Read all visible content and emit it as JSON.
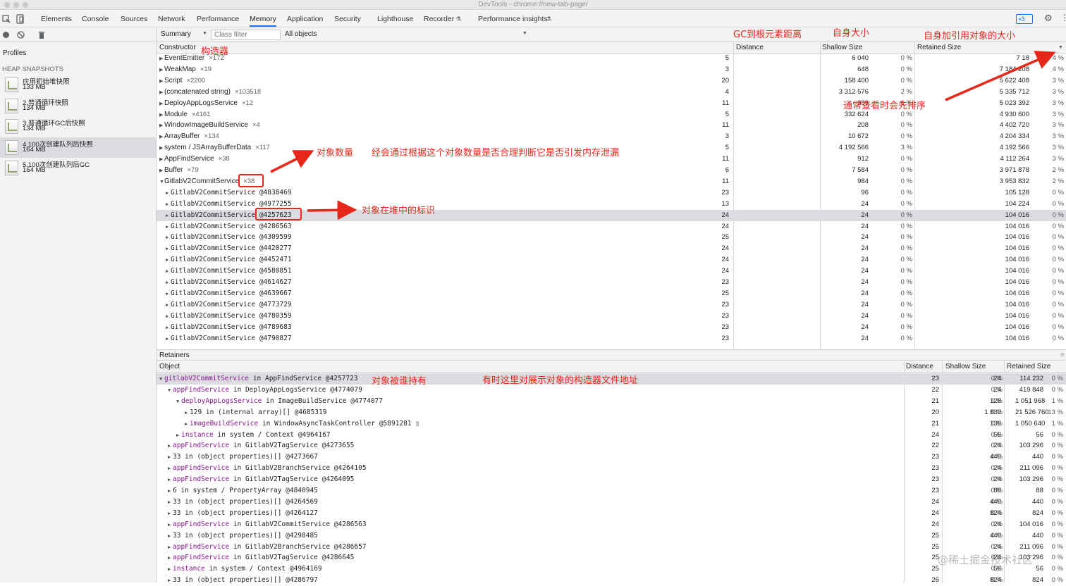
{
  "window": {
    "title": "DevTools - chrome://new-tab-page/"
  },
  "tabs": [
    "Elements",
    "Console",
    "Sources",
    "Network",
    "Performance",
    "Memory",
    "Application",
    "Security",
    "Lighthouse",
    "Recorder",
    "Performance insights"
  ],
  "active_tab": "Memory",
  "issues_badge": "3",
  "toolbar": {
    "view": "Summary",
    "class_filter_placeholder": "Class filter",
    "objects": "All objects"
  },
  "sidebar": {
    "profiles_label": "Profiles",
    "section": "HEAP SNAPSHOTS",
    "snapshots": [
      {
        "name": "应用初始堆快照",
        "size": "133 MB"
      },
      {
        "name": "2.普通循环快照",
        "size": "134 MB"
      },
      {
        "name": "3.普通循环GC后快照",
        "size": "134 MB"
      },
      {
        "name": "4.100次创建队列后快照",
        "size": "164 MB"
      },
      {
        "name": "5.100次创建队列后GC",
        "size": "164 MB"
      }
    ],
    "selected_index": 3
  },
  "summary": {
    "headers": {
      "constructor": "Constructor",
      "distance": "Distance",
      "shallow": "Shallow Size",
      "retained": "Retained Size"
    },
    "rows": [
      {
        "name": "EventEmitter",
        "count": "×172",
        "dist": "5",
        "shallow": "6 040",
        "sp": "0 %",
        "retained": "7 18",
        "rp": "4 %"
      },
      {
        "name": "WeakMap",
        "count": "×19",
        "dist": "3",
        "shallow": "648",
        "sp": "0 %",
        "retained": "7 184 208",
        "rp": "4 %"
      },
      {
        "name": "Script",
        "count": "×2200",
        "dist": "20",
        "shallow": "158 400",
        "sp": "0 %",
        "retained": "5 622 408",
        "rp": "3 %"
      },
      {
        "name": "(concatenated string)",
        "count": "×103518",
        "dist": "4",
        "shallow": "3 312 576",
        "sp": "2 %",
        "retained": "5 335 712",
        "rp": "3 %"
      },
      {
        "name": "DeployAppLogsService",
        "count": "×12",
        "dist": "11",
        "shallow": "289",
        "sp": "0 %",
        "retained": "5 023 392",
        "rp": "3 %"
      },
      {
        "name": "Module",
        "count": "×4161",
        "dist": "5",
        "shallow": "332 624",
        "sp": "0 %",
        "retained": "4 930 600",
        "rp": "3 %"
      },
      {
        "name": "WindowImageBuildService",
        "count": "×4",
        "dist": "11",
        "shallow": "208",
        "sp": "0 %",
        "retained": "4 402 720",
        "rp": "3 %"
      },
      {
        "name": "ArrayBuffer",
        "count": "×134",
        "dist": "3",
        "shallow": "10 672",
        "sp": "0 %",
        "retained": "4 204 334",
        "rp": "3 %"
      },
      {
        "name": "system / JSArrayBufferData",
        "count": "×117",
        "dist": "5",
        "shallow": "4 192 566",
        "sp": "3 %",
        "retained": "4 192 566",
        "rp": "3 %"
      },
      {
        "name": "AppFindService",
        "count": "×38",
        "dist": "11",
        "shallow": "912",
        "sp": "0 %",
        "retained": "4 112 264",
        "rp": "3 %"
      },
      {
        "name": "Buffer",
        "count": "×79",
        "dist": "6",
        "shallow": "7 584",
        "sp": "0 %",
        "retained": "3 971 878",
        "rp": "2 %"
      },
      {
        "name": "GitlabV2CommitService",
        "count": "×38",
        "dist": "11",
        "shallow": "984",
        "sp": "0 %",
        "retained": "3 953 832",
        "rp": "2 %",
        "expanded": true
      }
    ],
    "children": [
      {
        "name": "GitlabV2CommitService @4838469",
        "dist": "23",
        "shallow": "96",
        "sp": "0 %",
        "retained": "105 128",
        "rp": "0 %"
      },
      {
        "name": "GitlabV2CommitService @4977255",
        "dist": "13",
        "shallow": "24",
        "sp": "0 %",
        "retained": "104 224",
        "rp": "0 %"
      },
      {
        "name": "GitlabV2CommitService @4257623",
        "dist": "24",
        "shallow": "24",
        "sp": "0 %",
        "retained": "104 016",
        "rp": "0 %",
        "selected": true
      },
      {
        "name": "GitlabV2CommitService @4286563",
        "dist": "24",
        "shallow": "24",
        "sp": "0 %",
        "retained": "104 016",
        "rp": "0 %"
      },
      {
        "name": "GitlabV2CommitService @4309599",
        "dist": "25",
        "shallow": "24",
        "sp": "0 %",
        "retained": "104 016",
        "rp": "0 %"
      },
      {
        "name": "GitlabV2CommitService @4420277",
        "dist": "24",
        "shallow": "24",
        "sp": "0 %",
        "retained": "104 016",
        "rp": "0 %"
      },
      {
        "name": "GitlabV2CommitService @4452471",
        "dist": "24",
        "shallow": "24",
        "sp": "0 %",
        "retained": "104 016",
        "rp": "0 %"
      },
      {
        "name": "GitlabV2CommitService @4580851",
        "dist": "24",
        "shallow": "24",
        "sp": "0 %",
        "retained": "104 016",
        "rp": "0 %"
      },
      {
        "name": "GitlabV2CommitService @4614627",
        "dist": "23",
        "shallow": "24",
        "sp": "0 %",
        "retained": "104 016",
        "rp": "0 %"
      },
      {
        "name": "GitlabV2CommitService @4639667",
        "dist": "25",
        "shallow": "24",
        "sp": "0 %",
        "retained": "104 016",
        "rp": "0 %"
      },
      {
        "name": "GitlabV2CommitService @4773729",
        "dist": "23",
        "shallow": "24",
        "sp": "0 %",
        "retained": "104 016",
        "rp": "0 %"
      },
      {
        "name": "GitlabV2CommitService @4780359",
        "dist": "23",
        "shallow": "24",
        "sp": "0 %",
        "retained": "104 016",
        "rp": "0 %"
      },
      {
        "name": "GitlabV2CommitService @4789683",
        "dist": "23",
        "shallow": "24",
        "sp": "0 %",
        "retained": "104 016",
        "rp": "0 %"
      },
      {
        "name": "GitlabV2CommitService @4790827",
        "dist": "23",
        "shallow": "24",
        "sp": "0 %",
        "retained": "104 016",
        "rp": "0 %"
      }
    ]
  },
  "retainers": {
    "title": "Retainers",
    "headers": {
      "object": "Object",
      "distance": "Distance",
      "shallow": "Shallow Size",
      "retained": "Retained Size"
    },
    "rows": [
      {
        "indent": 0,
        "open": true,
        "prop": "gitlabV2CommitService",
        "rest": " in AppFindService @4257723",
        "dist": "23",
        "shallow": "24",
        "sp": "0 %",
        "retained": "114 232",
        "rp": "0 %",
        "selected": true
      },
      {
        "indent": 1,
        "open": true,
        "prop": "appFindService",
        "rest": " in DeployAppLogsService @4774079",
        "dist": "22",
        "shallow": "24",
        "sp": "0 %",
        "retained": "419 848",
        "rp": "0 %"
      },
      {
        "indent": 2,
        "open": true,
        "prop": "deployAppLogsService",
        "rest": " in ImageBuildService @4774077",
        "dist": "21",
        "shallow": "128",
        "sp": "0 %",
        "retained": "1 051 968",
        "rp": "1 %"
      },
      {
        "indent": 3,
        "open": false,
        "prop": "",
        "rest": "129 in (internal array)[] @4685319",
        "dist": "20",
        "shallow": "1 832",
        "sp": "0 %",
        "retained": "21 526 760",
        "rp": "13 %"
      },
      {
        "indent": 3,
        "open": false,
        "prop": "imageBuildService",
        "rest": " in WindowAsyncTaskController @5891281 ▯",
        "dist": "21",
        "shallow": "136",
        "sp": "0 %",
        "retained": "1 050 640",
        "rp": "1 %"
      },
      {
        "indent": 2,
        "open": false,
        "prop": "instance",
        "rest": " in system / Context @4964167",
        "dist": "24",
        "shallow": "56",
        "sp": "0 %",
        "retained": "56",
        "rp": "0 %"
      },
      {
        "indent": 1,
        "open": false,
        "prop": "appFindService",
        "rest": " in GitlabV2TagService @4273655",
        "dist": "22",
        "shallow": "24",
        "sp": "0 %",
        "retained": "103 296",
        "rp": "0 %"
      },
      {
        "indent": 1,
        "open": false,
        "prop": "",
        "rest": "33 in (object properties)[] @4273667",
        "dist": "23",
        "shallow": "440",
        "sp": "0 %",
        "retained": "440",
        "rp": "0 %"
      },
      {
        "indent": 1,
        "open": false,
        "prop": "appFindService",
        "rest": " in GitlabV2BranchService @4264105",
        "dist": "23",
        "shallow": "24",
        "sp": "0 %",
        "retained": "211 096",
        "rp": "0 %"
      },
      {
        "indent": 1,
        "open": false,
        "prop": "appFindService",
        "rest": " in GitlabV2TagService @4264095",
        "dist": "23",
        "shallow": "24",
        "sp": "0 %",
        "retained": "103 296",
        "rp": "0 %"
      },
      {
        "indent": 1,
        "open": false,
        "prop": "",
        "rest": "6 in system / PropertyArray @4840945",
        "dist": "23",
        "shallow": "88",
        "sp": "0 %",
        "retained": "88",
        "rp": "0 %"
      },
      {
        "indent": 1,
        "open": false,
        "prop": "",
        "rest": "33 in (object properties)[] @4264569",
        "dist": "24",
        "shallow": "440",
        "sp": "0 %",
        "retained": "440",
        "rp": "0 %"
      },
      {
        "indent": 1,
        "open": false,
        "prop": "",
        "rest": "33 in (object properties)[] @4264127",
        "dist": "24",
        "shallow": "824",
        "sp": "0 %",
        "retained": "824",
        "rp": "0 %"
      },
      {
        "indent": 1,
        "open": false,
        "prop": "appFindService",
        "rest": " in GitlabV2CommitService @4286563",
        "dist": "24",
        "shallow": "24",
        "sp": "0 %",
        "retained": "104 016",
        "rp": "0 %"
      },
      {
        "indent": 1,
        "open": false,
        "prop": "",
        "rest": "33 in (object properties)[] @4298485",
        "dist": "25",
        "shallow": "440",
        "sp": "0 %",
        "retained": "440",
        "rp": "0 %"
      },
      {
        "indent": 1,
        "open": false,
        "prop": "appFindService",
        "rest": " in GitlabV2BranchService @4286657",
        "dist": "25",
        "shallow": "24",
        "sp": "0 %",
        "retained": "211 096",
        "rp": "0 %"
      },
      {
        "indent": 1,
        "open": false,
        "prop": "appFindService",
        "rest": " in GitlabV2TagService @4286645",
        "dist": "25",
        "shallow": "24",
        "sp": "0 %",
        "retained": "103 296",
        "rp": "0 %"
      },
      {
        "indent": 1,
        "open": false,
        "prop": "instance",
        "rest": " in system / Context @4964169",
        "dist": "25",
        "shallow": "56",
        "sp": "0 %",
        "retained": "56",
        "rp": "0 %"
      },
      {
        "indent": 1,
        "open": false,
        "prop": "",
        "rest": "33 in (object properties)[] @4286797",
        "dist": "26",
        "shallow": "824",
        "sp": "0 %",
        "retained": "824",
        "rp": "0 %"
      }
    ]
  },
  "annotations": {
    "constructor": "构造器",
    "gc_distance": "GC到根元素距离",
    "shallow": "自身大小",
    "retained": "自身加引用对象的大小",
    "sort_hint": "通常查看时会先排序",
    "object_count": "对象数量",
    "object_count_hint": "经会通过根据这个对象数量是否合理判断它是否引发内存泄漏",
    "heap_id": "对象在堆中的标识",
    "held_by": "对象被谁持有",
    "file_hint": "有时这里对展示对象的构造器文件地址"
  },
  "watermark": "@稀土掘金技术社区",
  "colors": {
    "annotation": "#e8271b",
    "selected_row": "#dadce0",
    "property": "#881391",
    "accent": "#1a73e8"
  }
}
